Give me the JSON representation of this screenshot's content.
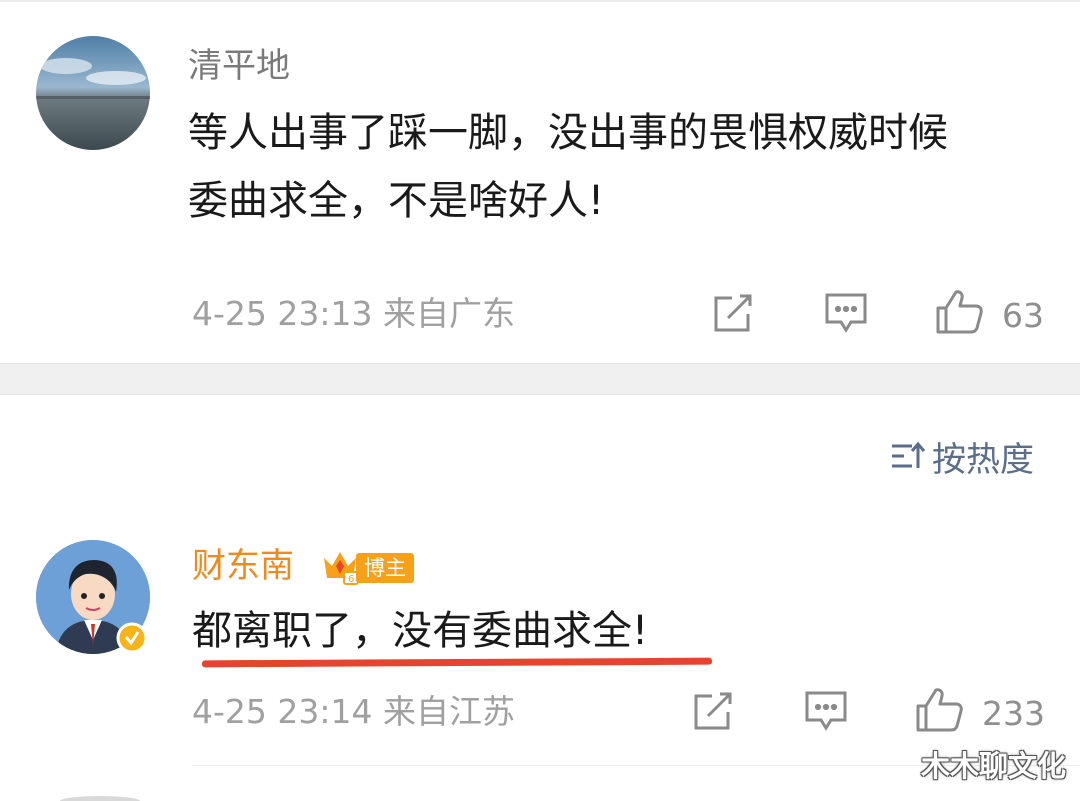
{
  "comments": [
    {
      "username": "清平地",
      "content_line1": "等人出事了踩一脚，没出事的畏惧权威时候",
      "content_line2": "委曲求全，不是啥好人!",
      "timestamp": "4-25 23:13",
      "location": "来自广东",
      "likes": "63"
    },
    {
      "username": "财东南",
      "badge": "博主",
      "content_line1": "都离职了，没有委曲求全!",
      "timestamp": "4-25 23:14",
      "location": "来自江苏",
      "likes": "233"
    }
  ],
  "sort": {
    "label": "按热度"
  },
  "watermark": "木木聊文化",
  "colors": {
    "username_regular": "#7a7a7a",
    "username_vip": "#f08a1c",
    "badge": "#f7a11a",
    "underline": "#e5452f",
    "meta": "#a0a0a0",
    "sort": "#5a6e8c"
  },
  "icons": [
    "repost-icon",
    "comment-icon",
    "like-icon",
    "sort-icon",
    "crown-icon",
    "verified-icon"
  ]
}
